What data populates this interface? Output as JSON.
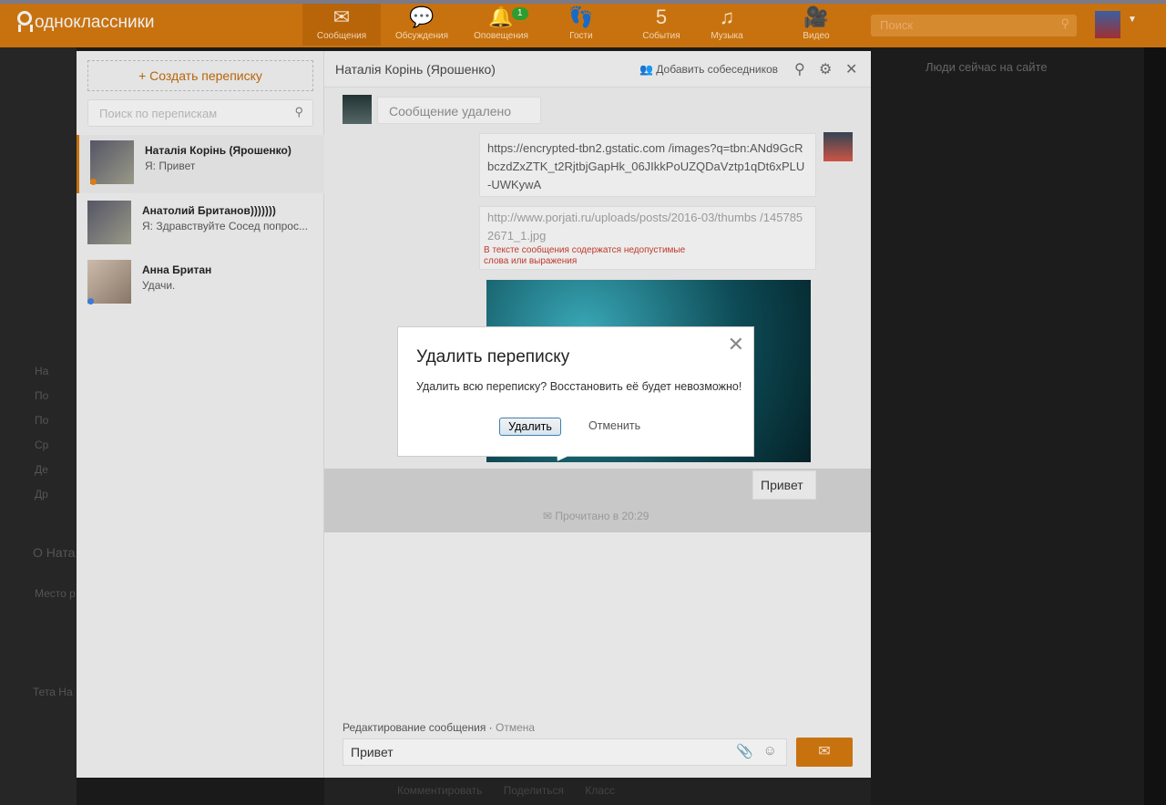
{
  "header": {
    "logo": "одноклассники",
    "nav": [
      {
        "label": "Сообщения",
        "icon": "envelope-icon"
      },
      {
        "label": "Обсуждения",
        "icon": "chat-bubbles-icon"
      },
      {
        "label": "Оповещения",
        "icon": "bell-icon",
        "badge": "1"
      },
      {
        "label": "Гости",
        "icon": "footprints-icon"
      },
      {
        "label": "События",
        "icon": "events-icon",
        "badge": "5"
      },
      {
        "label": "Музыка",
        "icon": "music-icon"
      },
      {
        "label": "Видео",
        "icon": "video-camera-icon"
      }
    ],
    "search_placeholder": "Поиск"
  },
  "left_page": {
    "items": [
      "На",
      "По",
      "По",
      "Ср",
      "Де",
      "Др"
    ],
    "about": "О Ната",
    "place": "Место р",
    "friend": "Тета На"
  },
  "right_page": {
    "title": "Люди сейчас на сайте"
  },
  "messenger": {
    "create_label": "Создать переписку",
    "search_placeholder": "Поиск по перепискам",
    "conversations": [
      {
        "name": "Наталія Корінь (Ярошенко)",
        "last": "Я: Привет",
        "status_color": "#e07b10"
      },
      {
        "name": "Анатолий Британов)))))))",
        "last": "Я: Здравствуйте Сосед попрос...",
        "status_color": ""
      },
      {
        "name": "Анна Британ",
        "last": "Удачи.",
        "status_color": "#3a7bd5"
      }
    ],
    "chat": {
      "title": "Наталія Корінь (Ярошенко)",
      "add_label": "Добавить собеседников",
      "messages": [
        {
          "text": "Сообщение удалено"
        },
        {
          "text": "https://encrypted-tbn2.gstatic.com /images?q=tbn:ANd9GcRbczdZxZTK_t2RjtbjGapHk_06JIkkPoUZQDaVztp1qDt6xPLU-UWKywA"
        },
        {
          "text": "http://www.porjati.ru/uploads/posts/2016-03/thumbs /1457852671_1.jpg",
          "error": "В тексте сообщения содержатся недопустимые слова или выражения"
        },
        {
          "text": "Привет"
        }
      ],
      "read_status": "Прочитано в 20:29",
      "edit_label": "Редактирование сообщения",
      "edit_cancel": "Отмена",
      "input_value": "Привет"
    },
    "bottom": [
      "Комментировать",
      "Поделиться",
      "Класс"
    ]
  },
  "dialog": {
    "title": "Удалить переписку",
    "text": "Удалить всю переписку? Восстановить её будет невозможно!",
    "confirm": "Удалить",
    "cancel": "Отменить"
  }
}
